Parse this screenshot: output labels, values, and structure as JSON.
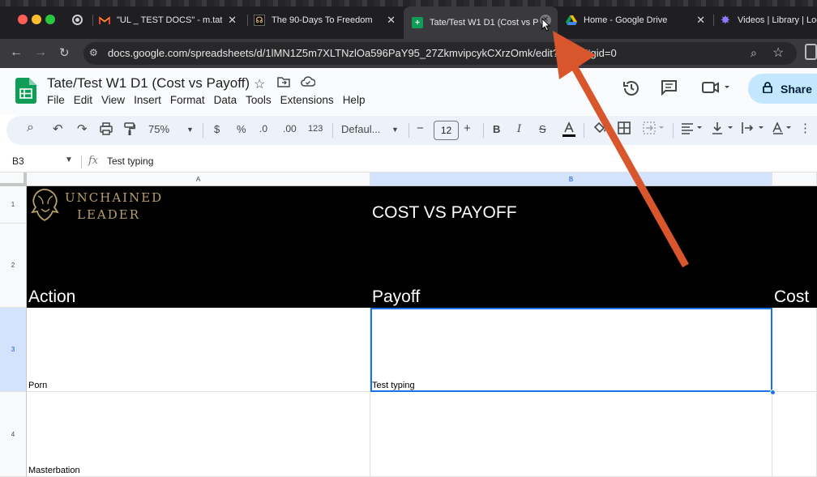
{
  "browser": {
    "tabs": [
      {
        "favicon": "gmail-icon",
        "title": "\"UL _ TEST DOCS\" - m.tate",
        "close": "✕"
      },
      {
        "favicon": "course-icon",
        "title": "The 90-Days To Freedom",
        "close": "✕"
      },
      {
        "favicon": "sheets-icon",
        "title": "Tate/Test W1 D1 (Cost vs Pa",
        "close": "✕",
        "active": true
      },
      {
        "favicon": "drive-icon",
        "title": "Home - Google Drive",
        "close": "✕"
      },
      {
        "favicon": "library-icon",
        "title": "Videos | Library | Loo"
      }
    ],
    "url": "docs.google.com/spreadsheets/d/1lMN1Z5m7XLTNzlOa596PaY95_27ZkmvipcykCXrzOmk/edit?gid=0#gid=0",
    "colors": {
      "tab_strip": "#1f1f23",
      "active_tab": "#3a3a3e"
    }
  },
  "sheets": {
    "doc_title": "Tate/Test W1 D1 (Cost vs Payoff)",
    "menu": [
      "File",
      "Edit",
      "View",
      "Insert",
      "Format",
      "Data",
      "Tools",
      "Extensions",
      "Help"
    ],
    "share_label": "Share",
    "toolbar": {
      "zoom": "75%",
      "currency": "$",
      "percent": "%",
      "decrease_decimal": ".0",
      "increase_decimal": ".00",
      "number_format": "123",
      "font": "Defaul...",
      "minus": "−",
      "font_size": "12",
      "plus": "+",
      "bold": "B",
      "italic": "I"
    },
    "name_box": "B3",
    "fx": "fx",
    "formula_content": "Test typing",
    "columns": [
      {
        "label": "A",
        "selected": false
      },
      {
        "label": "B",
        "selected": true
      }
    ],
    "rows": [
      {
        "num": "1",
        "selected": false
      },
      {
        "num": "2",
        "selected": false
      },
      {
        "num": "3",
        "selected": true
      },
      {
        "num": "4",
        "selected": false
      }
    ],
    "banner": {
      "logo_line1": "UNCHAINED",
      "logo_line2": "LEADER",
      "title": "COST VS PAYOFF",
      "col_a_header": "Action",
      "col_b_header": "Payoff",
      "col_c_header": "Cost"
    },
    "cells": {
      "A3": "Porn",
      "B3": "Test typing",
      "A4": "Masterbation"
    },
    "colors": {
      "accent": "#1a73e8",
      "share": "#c2e7ff",
      "banner": "#000000",
      "logo_gold": "#b8a06a",
      "arrow": "#d9552b"
    }
  }
}
